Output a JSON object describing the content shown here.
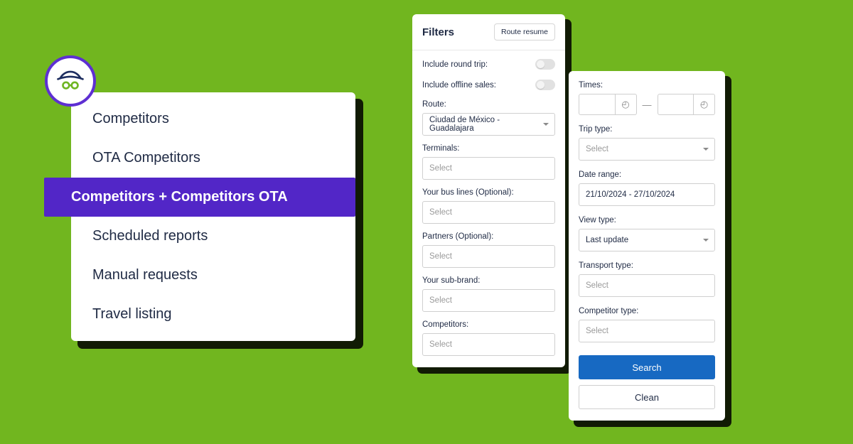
{
  "sidebar": {
    "items": [
      {
        "label": "Competitors"
      },
      {
        "label": "OTA Competitors"
      },
      {
        "label": "Competitors + Competitors OTA"
      },
      {
        "label": "Scheduled reports"
      },
      {
        "label": "Manual requests"
      },
      {
        "label": "Travel listing"
      }
    ],
    "active_index": 2
  },
  "filters": {
    "title": "Filters",
    "route_resume_label": "Route resume",
    "include_round_trip_label": "Include round trip:",
    "include_offline_sales_label": "Include offline sales:",
    "route_label": "Route:",
    "route_value": "Ciudad de México - Guadalajara",
    "terminals_label": "Terminals:",
    "terminals_placeholder": "Select",
    "bus_lines_label": "Your bus lines (Optional):",
    "bus_lines_placeholder": "Select",
    "partners_label": "Partners (Optional):",
    "partners_placeholder": "Select",
    "sub_brand_label": "Your sub-brand:",
    "sub_brand_placeholder": "Select",
    "competitors_label": "Competitors:",
    "competitors_placeholder": "Select"
  },
  "right": {
    "times_label": "Times:",
    "trip_type_label": "Trip type:",
    "trip_type_placeholder": "Select",
    "date_range_label": "Date range:",
    "date_range_value": "21/10/2024 - 27/10/2024",
    "view_type_label": "View type:",
    "view_type_value": "Last update",
    "transport_type_label": "Transport type:",
    "transport_type_placeholder": "Select",
    "competitor_type_label": "Competitor type:",
    "competitor_type_placeholder": "Select",
    "search_label": "Search",
    "clean_label": "Clean"
  }
}
